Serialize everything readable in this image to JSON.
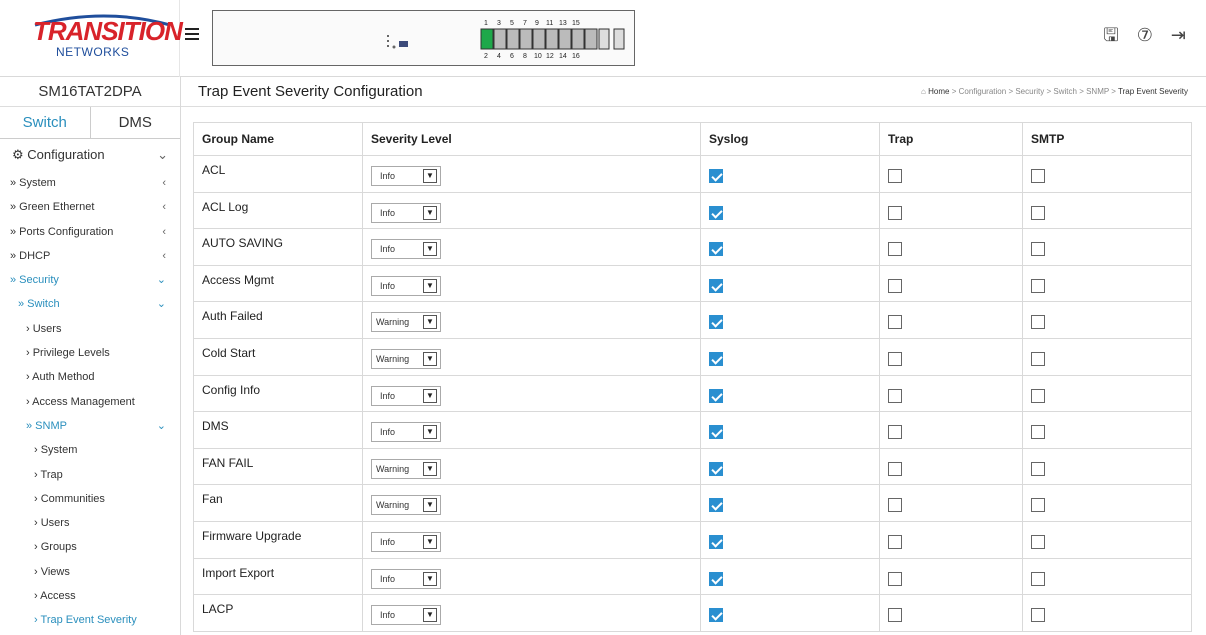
{
  "brand": {
    "line1": "TRANSITION",
    "line2": "NETWORKS"
  },
  "device_name": "SM16TAT2DPA",
  "tabs": [
    {
      "label": "Switch"
    },
    {
      "label": "DMS"
    }
  ],
  "nav": {
    "config_label": "Configuration",
    "items": [
      {
        "label": "» System",
        "chev": "‹"
      },
      {
        "label": "» Green Ethernet",
        "chev": "‹"
      },
      {
        "label": "» Ports Configuration",
        "chev": "‹"
      },
      {
        "label": "» DHCP",
        "chev": "‹"
      },
      {
        "label": "» Security",
        "chev": "⌄"
      },
      {
        "label": "» Switch",
        "chev": "⌄"
      },
      {
        "label": "› Users",
        "chev": ""
      },
      {
        "label": "› Privilege Levels",
        "chev": ""
      },
      {
        "label": "› Auth Method",
        "chev": ""
      },
      {
        "label": "› Access Management",
        "chev": ""
      },
      {
        "label": "» SNMP",
        "chev": "⌄"
      },
      {
        "label": "› System",
        "chev": ""
      },
      {
        "label": "› Trap",
        "chev": ""
      },
      {
        "label": "› Communities",
        "chev": ""
      },
      {
        "label": "› Users",
        "chev": ""
      },
      {
        "label": "› Groups",
        "chev": ""
      },
      {
        "label": "› Views",
        "chev": ""
      },
      {
        "label": "› Access",
        "chev": ""
      },
      {
        "label": "› Trap Event Severity",
        "chev": ""
      }
    ]
  },
  "page_title": "Trap Event Severity Configuration",
  "breadcrumb": {
    "home": "Home",
    "parts": [
      "Configuration",
      "Security",
      "Switch",
      "SNMP"
    ],
    "current": "Trap Event Severity",
    "sep": ">"
  },
  "table": {
    "headers": [
      "Group Name",
      "Severity Level",
      "Syslog",
      "Trap",
      "SMTP"
    ],
    "rows": [
      {
        "name": "ACL",
        "severity": "Info",
        "syslog": true,
        "trap": false,
        "smtp": false
      },
      {
        "name": "ACL Log",
        "severity": "Info",
        "syslog": true,
        "trap": false,
        "smtp": false
      },
      {
        "name": "AUTO SAVING",
        "severity": "Info",
        "syslog": true,
        "trap": false,
        "smtp": false
      },
      {
        "name": "Access Mgmt",
        "severity": "Info",
        "syslog": true,
        "trap": false,
        "smtp": false
      },
      {
        "name": "Auth Failed",
        "severity": "Warning",
        "syslog": true,
        "trap": false,
        "smtp": false
      },
      {
        "name": "Cold Start",
        "severity": "Warning",
        "syslog": true,
        "trap": false,
        "smtp": false
      },
      {
        "name": "Config Info",
        "severity": "Info",
        "syslog": true,
        "trap": false,
        "smtp": false
      },
      {
        "name": "DMS",
        "severity": "Info",
        "syslog": true,
        "trap": false,
        "smtp": false
      },
      {
        "name": "FAN FAIL",
        "severity": "Warning",
        "syslog": true,
        "trap": false,
        "smtp": false
      },
      {
        "name": "Fan",
        "severity": "Warning",
        "syslog": true,
        "trap": false,
        "smtp": false
      },
      {
        "name": "Firmware Upgrade",
        "severity": "Info",
        "syslog": true,
        "trap": false,
        "smtp": false
      },
      {
        "name": "Import Export",
        "severity": "Info",
        "syslog": true,
        "trap": false,
        "smtp": false
      },
      {
        "name": "LACP",
        "severity": "Info",
        "syslog": true,
        "trap": false,
        "smtp": false
      }
    ]
  },
  "colors": {
    "accent": "#2a8fbd",
    "brand_red": "#d8232a",
    "brand_blue": "#1f4e9c",
    "checkbox": "#2a8fd0"
  },
  "icons": [
    "menu-icon",
    "save-icon",
    "help-icon",
    "logout-icon",
    "gear-icon"
  ]
}
